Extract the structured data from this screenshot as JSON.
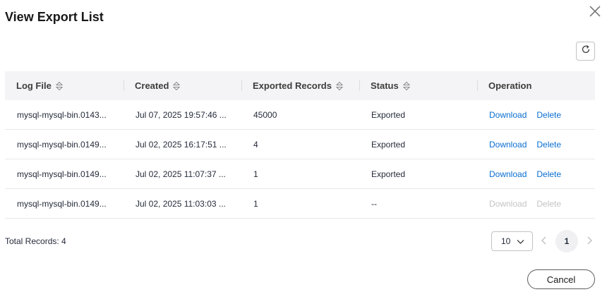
{
  "dialog": {
    "title": "View Export List",
    "close_icon": "close-icon",
    "refresh_icon": "refresh-icon"
  },
  "table": {
    "columns": [
      {
        "label": "Log File",
        "sortable": true
      },
      {
        "label": "Created",
        "sortable": true
      },
      {
        "label": "Exported Records",
        "sortable": true
      },
      {
        "label": "Status",
        "sortable": true
      },
      {
        "label": "Operation",
        "sortable": false
      }
    ],
    "rows": [
      {
        "log_file": "mysql-mysql-bin.0143...",
        "created": "Jul 07, 2025 19:57:46 ...",
        "records": "45000",
        "status": "Exported",
        "download": "Download",
        "delete": "Delete",
        "enabled": true
      },
      {
        "log_file": "mysql-mysql-bin.0149...",
        "created": "Jul 02, 2025 16:17:51 ...",
        "records": "4",
        "status": "Exported",
        "download": "Download",
        "delete": "Delete",
        "enabled": true
      },
      {
        "log_file": "mysql-mysql-bin.0149...",
        "created": "Jul 02, 2025 11:07:37 ...",
        "records": "1",
        "status": "Exported",
        "download": "Download",
        "delete": "Delete",
        "enabled": true
      },
      {
        "log_file": "mysql-mysql-bin.0149...",
        "created": "Jul 02, 2025 11:03:03 ...",
        "records": "1",
        "status": "--",
        "download": "Download",
        "delete": "Delete",
        "enabled": false
      }
    ]
  },
  "footer": {
    "total_label": "Total Records: 4",
    "page_size": "10",
    "current_page": "1",
    "cancel_label": "Cancel"
  },
  "colors": {
    "link": "#0a6ed1",
    "link_disabled": "#c4c4c4",
    "header_bg": "#f4f4f6"
  }
}
